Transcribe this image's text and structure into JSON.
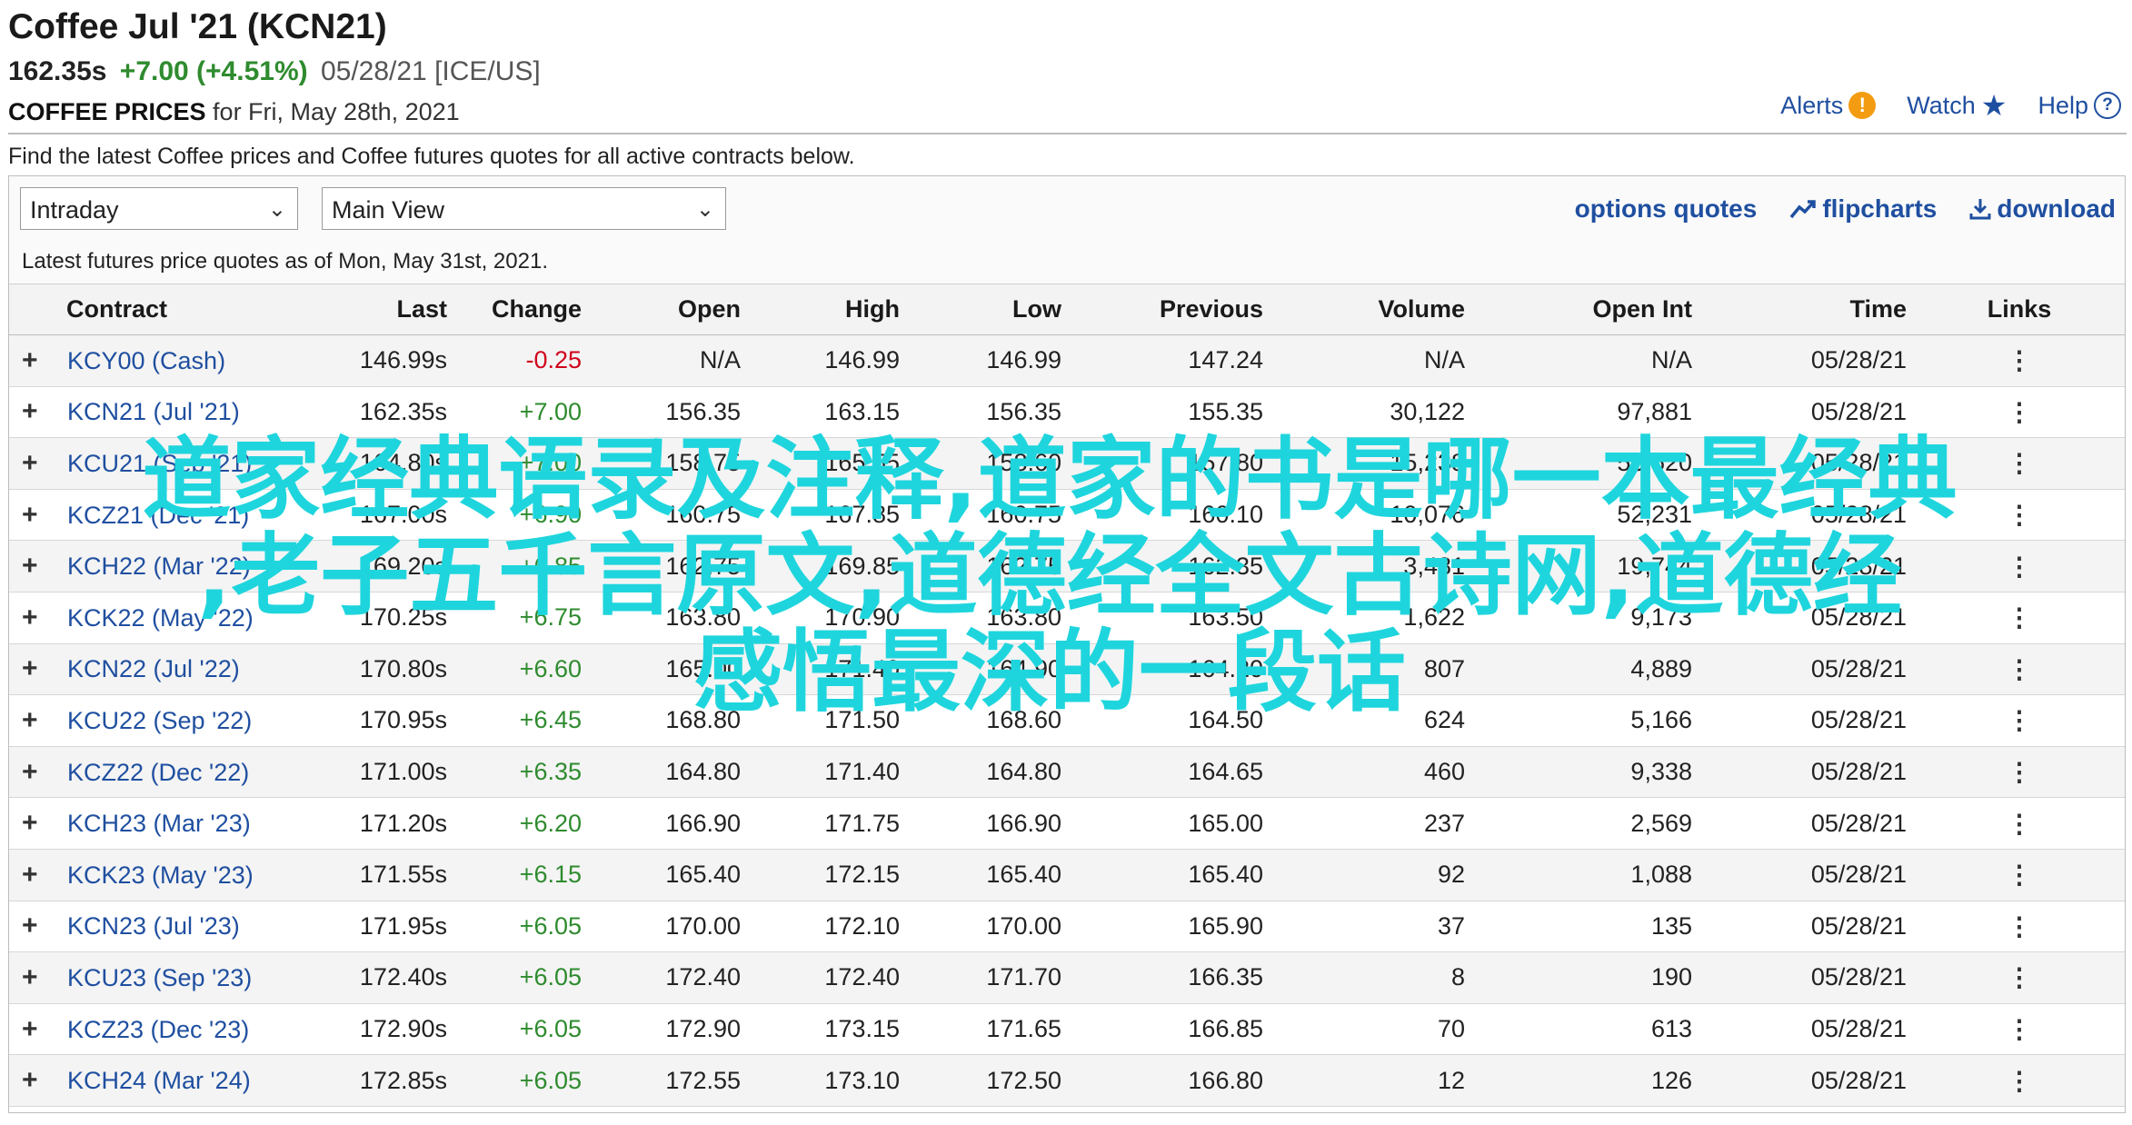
{
  "header": {
    "title": "Coffee Jul '21 (KCN21)",
    "last_price": "162.35s",
    "change": "+7.00 (+4.51%)",
    "date_exchange": "05/28/21 [ICE/US]",
    "prices_label": "COFFEE PRICES",
    "prices_date": "for Fri, May 28th, 2021"
  },
  "top_links": {
    "alerts": "Alerts",
    "alert_icon": "!",
    "watch": "Watch",
    "watch_icon": "★",
    "help": "Help",
    "help_icon": "?"
  },
  "description": "Find the latest Coffee prices and Coffee futures quotes for all active contracts below.",
  "controls": {
    "interval_select": "Intraday",
    "view_select": "Main View",
    "options_quotes": "options quotes",
    "flipcharts": "flipcharts",
    "download": "download"
  },
  "as_of": "Latest futures price quotes as of Mon, May 31st, 2021.",
  "table": {
    "headers": {
      "contract": "Contract",
      "last": "Last",
      "change": "Change",
      "open": "Open",
      "high": "High",
      "low": "Low",
      "previous": "Previous",
      "volume": "Volume",
      "open_int": "Open Int",
      "time": "Time",
      "links": "Links"
    },
    "rows": [
      {
        "contract": "KCY00 (Cash)",
        "last": "146.99s",
        "change": "-0.25",
        "open": "N/A",
        "high": "146.99",
        "low": "146.99",
        "previous": "147.24",
        "volume": "N/A",
        "open_int": "N/A",
        "time": "05/28/21"
      },
      {
        "contract": "KCN21 (Jul '21)",
        "last": "162.35s",
        "change": "+7.00",
        "open": "156.35",
        "high": "163.15",
        "low": "156.35",
        "previous": "155.35",
        "volume": "30,122",
        "open_int": "97,881",
        "time": "05/28/21"
      },
      {
        "contract": "KCU21 (Sep '21)",
        "last": "164.80s",
        "change": "+7.00",
        "open": "158.75",
        "high": "165.55",
        "low": "158.60",
        "previous": "157.80",
        "volume": "15,238",
        "open_int": "53,620",
        "time": "05/28/21"
      },
      {
        "contract": "KCZ21 (Dec '21)",
        "last": "167.00s",
        "change": "+6.90",
        "open": "160.75",
        "high": "167.85",
        "low": "160.75",
        "previous": "160.10",
        "volume": "10,076",
        "open_int": "52,231",
        "time": "05/28/21"
      },
      {
        "contract": "KCH22 (Mar '22)",
        "last": "169.20s",
        "change": "+6.85",
        "open": "162.75",
        "high": "169.85",
        "low": "162.75",
        "previous": "162.35",
        "volume": "3,481",
        "open_int": "19,744",
        "time": "05/28/21"
      },
      {
        "contract": "KCK22 (May '22)",
        "last": "170.25s",
        "change": "+6.75",
        "open": "163.80",
        "high": "170.90",
        "low": "163.80",
        "previous": "163.50",
        "volume": "1,622",
        "open_int": "9,173",
        "time": "05/28/21"
      },
      {
        "contract": "KCN22 (Jul '22)",
        "last": "170.80s",
        "change": "+6.60",
        "open": "165.00",
        "high": "171.40",
        "low": "164.90",
        "previous": "164.20",
        "volume": "807",
        "open_int": "4,889",
        "time": "05/28/21"
      },
      {
        "contract": "KCU22 (Sep '22)",
        "last": "170.95s",
        "change": "+6.45",
        "open": "168.80",
        "high": "171.50",
        "low": "168.60",
        "previous": "164.50",
        "volume": "624",
        "open_int": "5,166",
        "time": "05/28/21"
      },
      {
        "contract": "KCZ22 (Dec '22)",
        "last": "171.00s",
        "change": "+6.35",
        "open": "164.80",
        "high": "171.40",
        "low": "164.80",
        "previous": "164.65",
        "volume": "460",
        "open_int": "9,338",
        "time": "05/28/21"
      },
      {
        "contract": "KCH23 (Mar '23)",
        "last": "171.20s",
        "change": "+6.20",
        "open": "166.90",
        "high": "171.75",
        "low": "166.90",
        "previous": "165.00",
        "volume": "237",
        "open_int": "2,569",
        "time": "05/28/21"
      },
      {
        "contract": "KCK23 (May '23)",
        "last": "171.55s",
        "change": "+6.15",
        "open": "165.40",
        "high": "172.15",
        "low": "165.40",
        "previous": "165.40",
        "volume": "92",
        "open_int": "1,088",
        "time": "05/28/21"
      },
      {
        "contract": "KCN23 (Jul '23)",
        "last": "171.95s",
        "change": "+6.05",
        "open": "170.00",
        "high": "172.10",
        "low": "170.00",
        "previous": "165.90",
        "volume": "37",
        "open_int": "135",
        "time": "05/28/21"
      },
      {
        "contract": "KCU23 (Sep '23)",
        "last": "172.40s",
        "change": "+6.05",
        "open": "172.40",
        "high": "172.40",
        "low": "171.70",
        "previous": "166.35",
        "volume": "8",
        "open_int": "190",
        "time": "05/28/21"
      },
      {
        "contract": "KCZ23 (Dec '23)",
        "last": "172.90s",
        "change": "+6.05",
        "open": "172.90",
        "high": "173.15",
        "low": "171.65",
        "previous": "166.85",
        "volume": "70",
        "open_int": "613",
        "time": "05/28/21"
      },
      {
        "contract": "KCH24 (Mar '24)",
        "last": "172.85s",
        "change": "+6.05",
        "open": "172.55",
        "high": "173.10",
        "low": "172.50",
        "previous": "166.80",
        "volume": "12",
        "open_int": "126",
        "time": "05/28/21"
      }
    ]
  },
  "overlay_text": {
    "line1": "道家经典语录及注释,道家的书是哪一本最经典",
    "line2": ",老子五千言原文,道德经全文古诗网,道德经",
    "line3": "感悟最深的一段话"
  },
  "colors": {
    "link_blue": "#1f4fa0",
    "positive": "#2e8b2e",
    "negative": "#d0021b",
    "overlay_cyan": "#1fd5dd",
    "alert_orange": "#f39c12"
  }
}
